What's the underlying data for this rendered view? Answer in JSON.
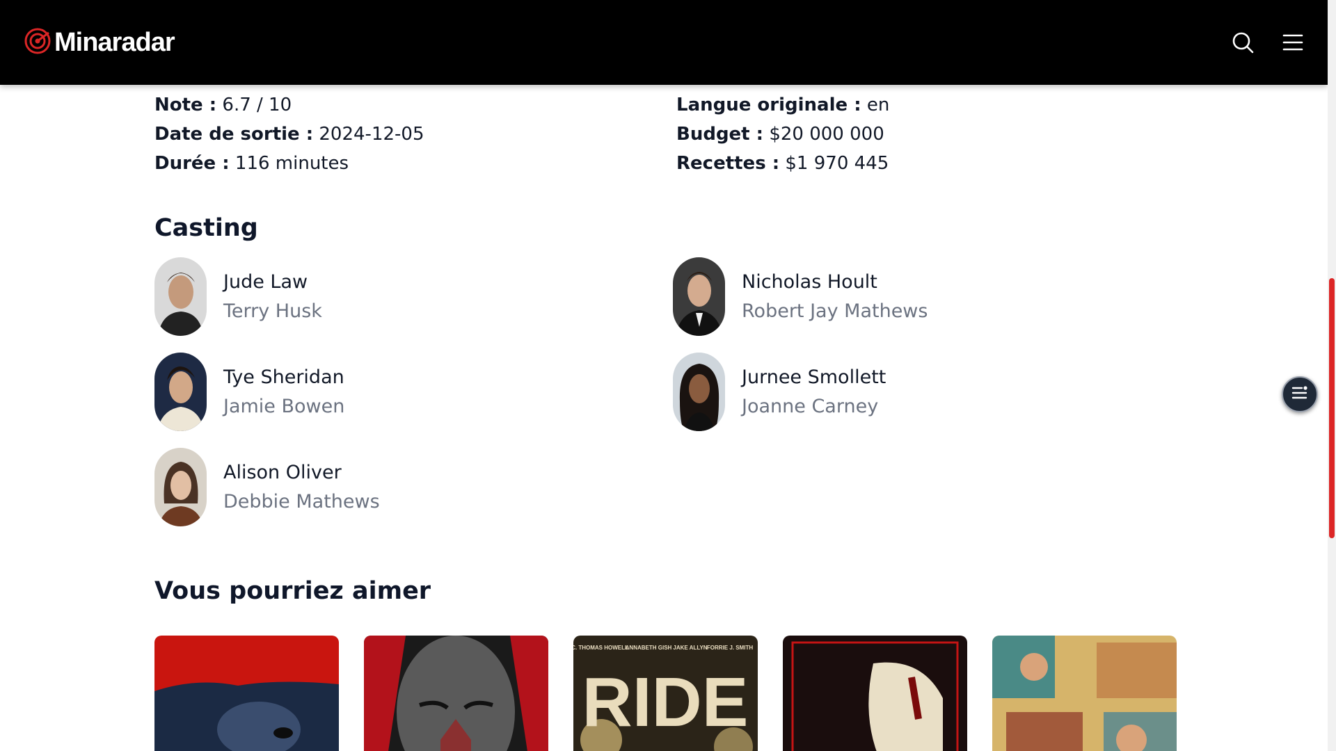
{
  "header": {
    "brand": "Minaradar",
    "logo_icon": "radar-icon",
    "search_icon": "search-icon",
    "menu_icon": "hamburger-menu-icon"
  },
  "details": {
    "left": [
      {
        "key": "Note :",
        "value": "6.7 / 10"
      },
      {
        "key": "Date de sortie :",
        "value": "2024-12-05"
      },
      {
        "key": "Durée :",
        "value": "116 minutes"
      }
    ],
    "right": [
      {
        "key": "Langue originale :",
        "value": "en"
      },
      {
        "key": "Budget :",
        "value": "$20 000 000"
      },
      {
        "key": "Recettes :",
        "value": "$1 970 445"
      }
    ]
  },
  "casting": {
    "title": "Casting",
    "members": [
      {
        "actor": "Jude Law",
        "role": "Terry Husk"
      },
      {
        "actor": "Nicholas Hoult",
        "role": "Robert Jay Mathews"
      },
      {
        "actor": "Tye Sheridan",
        "role": "Jamie Bowen"
      },
      {
        "actor": "Jurnee Smollett",
        "role": "Joanne Carney"
      },
      {
        "actor": "Alison Oliver",
        "role": "Debbie Mathews"
      }
    ]
  },
  "recommendations": {
    "title": "Vous pourriez aimer",
    "posters": [
      {
        "name": "poster-1"
      },
      {
        "name": "poster-2"
      },
      {
        "name": "poster-3",
        "credits": [
          "C. THOMAS HOWELL",
          "ANNABETH GISH",
          "JAKE ALLYN",
          "FORRIE J. SMITH"
        ],
        "title_text": "RIDE"
      },
      {
        "name": "poster-4"
      },
      {
        "name": "poster-5"
      }
    ]
  },
  "floating": {
    "icon": "table-of-contents-icon"
  },
  "colors": {
    "accent": "#dc2626",
    "header_bg": "#000000",
    "muted": "#6b7280"
  }
}
